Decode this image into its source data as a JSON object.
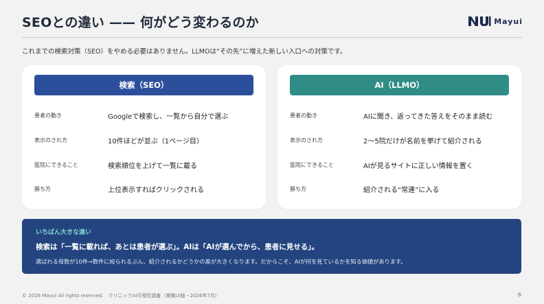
{
  "title": "SEOとの違い —— 何がどう変わるのか",
  "logo": {
    "text": "Mayui",
    "icon": "mayui-logo-mark"
  },
  "intro": "これまでの検索対策（SEO）をやめる必要はありません。LLMOは“その先”に増えた新しい入口への対策です。",
  "seo": {
    "header": "検索（SEO）",
    "rows": [
      {
        "label": "患者の動き",
        "value": "Googleで検索し、一覧から自分で選ぶ"
      },
      {
        "label": "表示のされ方",
        "value": "10件ほどが並ぶ（1ページ目）"
      },
      {
        "label": "医院にできること",
        "value": "検索順位を上げて一覧に載る"
      },
      {
        "label": "勝ち方",
        "value": "上位表示すればクリックされる"
      }
    ]
  },
  "ai": {
    "header": "AI（LLMO）",
    "rows": [
      {
        "label": "患者の動き",
        "value": "AIに聞き、返ってきた答えをそのまま読む"
      },
      {
        "label": "表示のされ方",
        "value": "2〜5院だけが名前を挙げて紹介される"
      },
      {
        "label": "医院にできること",
        "value": "AIが見るサイトに正しい情報を置く"
      },
      {
        "label": "勝ち方",
        "value": "紹介される“常連”に入る"
      }
    ]
  },
  "callout": {
    "tag": "いちばん大きな違い",
    "main": "検索は「一覧に載れば、あとは患者が選ぶ」。AIは「AIが選んでから、患者に見せる」。",
    "sub": "選ばれる母数が10件→数件に絞られるぶん、紹介されるかどうかの差が大きくなります。だからこそ、AIが何を見ているかを知る価値があります。"
  },
  "footer": "© 2026 Mayui All rights reserved.　クリニックAI可視性調査（実機UI版・2026年7月）",
  "page_number": "6",
  "colors": {
    "seo_header": "#2c4f9b",
    "ai_header": "#2f8d86",
    "callout_bg": "#23447f",
    "callout_tag": "#7fd6cf"
  }
}
